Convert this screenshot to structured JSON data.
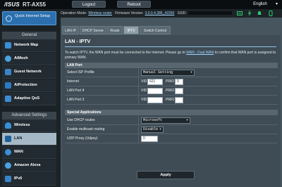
{
  "header": {
    "brand": "/ISUS",
    "model": "RT-AX55",
    "logout_label": "Logout",
    "reboot_label": "Reboot",
    "language": "English"
  },
  "opbar": {
    "op_mode_label": "Operation Mode:",
    "op_mode_value": "Wireless router",
    "firmware_label": "Firmware Version:",
    "firmware_value": "3.0.0.4.386_42350",
    "ssid_label": "SSID:"
  },
  "status_icons": [
    "network-status-icon",
    "usb-status-icon",
    "notification-icon",
    "app-icon"
  ],
  "sidebar": {
    "qis_label": "Quick Internet Setup",
    "general_header": "General",
    "general_items": [
      {
        "label": "Network Map",
        "icon": "network-map-icon"
      },
      {
        "label": "AiMesh",
        "icon": "aimesh-icon"
      },
      {
        "label": "Guest Network",
        "icon": "guest-network-icon"
      },
      {
        "label": "AiProtection",
        "icon": "aiprotection-icon"
      },
      {
        "label": "Adaptive QoS",
        "icon": "qos-icon"
      }
    ],
    "advanced_header": "Advanced Settings",
    "advanced_items": [
      {
        "label": "Wireless",
        "icon": "wireless-icon"
      },
      {
        "label": "LAN",
        "icon": "lan-icon"
      },
      {
        "label": "WAN",
        "icon": "wan-icon"
      },
      {
        "label": "Amazon Alexa",
        "icon": "alexa-icon"
      },
      {
        "label": "IPv6",
        "icon": "ipv6-icon"
      }
    ]
  },
  "tabs": [
    "LAN IP",
    "DHCP Server",
    "Route",
    "IPTV",
    "Switch Control"
  ],
  "active_tab": "IPTV",
  "page": {
    "title": "LAN - IPTV",
    "desc_part1": "To watch IPTV, the WAN port must be connected to the Internet. Please go to ",
    "desc_link": "WAN - Dual WAN",
    "desc_part2": " to confirm that WAN port is assigned to primary WAN."
  },
  "lan_port": {
    "header": "LAN Port",
    "isp_profile_label": "Select ISP Profile",
    "isp_profile_value": "Manual Setting",
    "internet_label": "Internet",
    "lan4_label": "LAN Port 4",
    "lan3_label": "LAN Port 3",
    "vid_label": "VID",
    "prio_label": "PRIO",
    "internet_vid": "621",
    "internet_prio": "0",
    "lan4_vid": "",
    "lan4_prio": "",
    "lan3_vid": "",
    "lan3_prio": ""
  },
  "special": {
    "header": "Special Applications",
    "dhcp_routes_label": "Use DHCP routes",
    "dhcp_routes_value": "Microsoft",
    "multicast_label": "Enable multicast routing",
    "multicast_value": "Disable",
    "udp_proxy_label": "UDP Proxy (Udpxy)",
    "udp_proxy_value": "0"
  },
  "apply_label": "Apply"
}
